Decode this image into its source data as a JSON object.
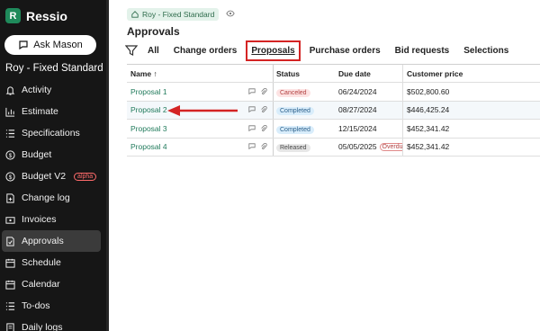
{
  "brand": {
    "name": "Ressio",
    "logo_letter": "R"
  },
  "assistant": {
    "label": "Ask Mason"
  },
  "project": {
    "name": "Roy - Fixed Standard"
  },
  "nav": [
    {
      "label": "Activity",
      "icon": "bell-icon"
    },
    {
      "label": "Estimate",
      "icon": "bar-chart-icon"
    },
    {
      "label": "Specifications",
      "icon": "list-icon"
    },
    {
      "label": "Budget",
      "icon": "dollar-icon"
    },
    {
      "label": "Budget V2",
      "icon": "dollar-icon",
      "badge": "alpha"
    },
    {
      "label": "Change log",
      "icon": "document-icon"
    },
    {
      "label": "Invoices",
      "icon": "invoice-icon"
    },
    {
      "label": "Approvals",
      "icon": "approval-icon",
      "active": true
    },
    {
      "label": "Schedule",
      "icon": "calendar-clock-icon"
    },
    {
      "label": "Calendar",
      "icon": "calendar-icon"
    },
    {
      "label": "To-dos",
      "icon": "checklist-icon"
    },
    {
      "label": "Daily logs",
      "icon": "notebook-icon"
    }
  ],
  "breadcrumb": {
    "label": "Roy - Fixed Standard"
  },
  "page": {
    "title": "Approvals"
  },
  "tabs": [
    {
      "label": "All"
    },
    {
      "label": "Change orders"
    },
    {
      "label": "Proposals",
      "active": true
    },
    {
      "label": "Purchase orders"
    },
    {
      "label": "Bid requests"
    },
    {
      "label": "Selections"
    }
  ],
  "table": {
    "columns": {
      "name": "Name ↑",
      "status": "Status",
      "due": "Due date",
      "price": "Customer price"
    },
    "rows": [
      {
        "name": "Proposal 1",
        "status": "Canceled",
        "due": "06/24/2024",
        "price": "$502,800.60"
      },
      {
        "name": "Proposal 2",
        "status": "Completed",
        "due": "08/27/2024",
        "price": "$446,425.24"
      },
      {
        "name": "Proposal 3",
        "status": "Completed",
        "due": "12/15/2024",
        "price": "$452,341.42"
      },
      {
        "name": "Proposal 4",
        "status": "Released",
        "due": "05/05/2025",
        "due_flag": "Overdue",
        "price": "$452,341.42"
      }
    ]
  },
  "colors": {
    "accent": "#1f8a5b",
    "highlight": "#d42424",
    "link": "#207a5b"
  }
}
